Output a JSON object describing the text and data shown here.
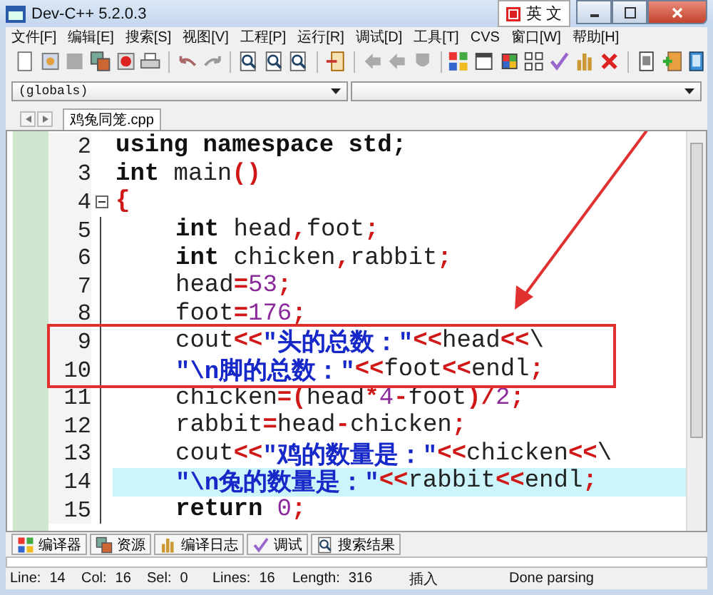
{
  "window": {
    "title": "Dev-C++ 5.2.0.3",
    "ime": "英 文"
  },
  "menu": [
    "文件[F]",
    "编辑[E]",
    "搜索[S]",
    "视图[V]",
    "工程[P]",
    "运行[R]",
    "调试[D]",
    "工具[T]",
    "CVS",
    "窗口[W]",
    "帮助[H]"
  ],
  "scope_combo": {
    "value": "(globals)"
  },
  "file_tabs": [
    {
      "label": "鸡兔同笼.cpp",
      "selected": true
    }
  ],
  "editor": {
    "lines": [
      {
        "number": "2",
        "highlighted": false,
        "tokens": [
          {
            "kind": "keyword",
            "text": "using namespace std;"
          }
        ]
      },
      {
        "number": "3",
        "highlighted": false,
        "tokens": [
          {
            "kind": "keyword",
            "text": "int"
          },
          {
            "kind": "plain",
            "text": " main"
          },
          {
            "kind": "op",
            "text": "()"
          }
        ]
      },
      {
        "number": "4",
        "highlighted": false,
        "tokens": [
          {
            "kind": "op",
            "text": "{"
          }
        ],
        "children": [
          {
            "number": "5",
            "highlighted": false,
            "tokens": [
              {
                "kind": "keyword",
                "text": "int"
              },
              {
                "kind": "plain",
                "text": " head"
              },
              {
                "kind": "op",
                "text": ","
              },
              {
                "kind": "plain",
                "text": "foot"
              },
              {
                "kind": "op",
                "text": ";"
              }
            ]
          },
          {
            "number": "6",
            "highlighted": false,
            "tokens": [
              {
                "kind": "keyword",
                "text": "int"
              },
              {
                "kind": "plain",
                "text": " chicken"
              },
              {
                "kind": "op",
                "text": ","
              },
              {
                "kind": "plain",
                "text": "rabbit"
              },
              {
                "kind": "op",
                "text": ";"
              }
            ]
          },
          {
            "number": "7",
            "highlighted": false,
            "tokens": [
              {
                "kind": "plain",
                "text": "head"
              },
              {
                "kind": "op",
                "text": "="
              },
              {
                "kind": "number",
                "text": "53"
              },
              {
                "kind": "op",
                "text": ";"
              }
            ]
          },
          {
            "number": "8",
            "highlighted": false,
            "tokens": [
              {
                "kind": "plain",
                "text": "foot"
              },
              {
                "kind": "op",
                "text": "="
              },
              {
                "kind": "number",
                "text": "176"
              },
              {
                "kind": "op",
                "text": ";"
              }
            ]
          },
          {
            "number": "9",
            "highlighted": false,
            "tokens": [
              {
                "kind": "plain",
                "text": "cout"
              },
              {
                "kind": "op",
                "text": "<<"
              },
              {
                "kind": "string",
                "text": "\"头的总数：\""
              },
              {
                "kind": "op",
                "text": "<<"
              },
              {
                "kind": "plain",
                "text": "head"
              },
              {
                "kind": "op",
                "text": "<<"
              },
              {
                "kind": "plain",
                "text": "\\"
              }
            ]
          },
          {
            "number": "10",
            "highlighted": false,
            "tokens": [
              {
                "kind": "string",
                "text": "\"\\n脚的总数：\""
              },
              {
                "kind": "op",
                "text": "<<"
              },
              {
                "kind": "plain",
                "text": "foot"
              },
              {
                "kind": "op",
                "text": "<<"
              },
              {
                "kind": "plain",
                "text": "endl"
              },
              {
                "kind": "op",
                "text": ";"
              }
            ]
          },
          {
            "number": "11",
            "highlighted": false,
            "tokens": [
              {
                "kind": "plain",
                "text": "chicken"
              },
              {
                "kind": "op",
                "text": "=("
              },
              {
                "kind": "plain",
                "text": "head"
              },
              {
                "kind": "op",
                "text": "*"
              },
              {
                "kind": "number",
                "text": "4"
              },
              {
                "kind": "op",
                "text": "-"
              },
              {
                "kind": "plain",
                "text": "foot"
              },
              {
                "kind": "op",
                "text": ")/"
              },
              {
                "kind": "number",
                "text": "2"
              },
              {
                "kind": "op",
                "text": ";"
              }
            ]
          },
          {
            "number": "12",
            "highlighted": false,
            "tokens": [
              {
                "kind": "plain",
                "text": "rabbit"
              },
              {
                "kind": "op",
                "text": "="
              },
              {
                "kind": "plain",
                "text": "head"
              },
              {
                "kind": "op",
                "text": "-"
              },
              {
                "kind": "plain",
                "text": "chicken"
              },
              {
                "kind": "op",
                "text": ";"
              }
            ]
          },
          {
            "number": "13",
            "highlighted": false,
            "tokens": [
              {
                "kind": "plain",
                "text": "cout"
              },
              {
                "kind": "op",
                "text": "<<"
              },
              {
                "kind": "string",
                "text": "\"鸡的数量是：\""
              },
              {
                "kind": "op",
                "text": "<<"
              },
              {
                "kind": "plain",
                "text": "chicken"
              },
              {
                "kind": "op",
                "text": "<<"
              },
              {
                "kind": "plain",
                "text": "\\"
              }
            ]
          },
          {
            "number": "14",
            "highlighted": true,
            "tokens": [
              {
                "kind": "string",
                "text": "\"\\n兔的数量是：\""
              },
              {
                "kind": "op",
                "text": "<<"
              },
              {
                "kind": "plain",
                "text": "rabbit"
              },
              {
                "kind": "op",
                "text": "<<"
              },
              {
                "kind": "plain",
                "text": "endl"
              },
              {
                "kind": "op",
                "text": ";"
              }
            ]
          },
          {
            "number": "15",
            "highlighted": false,
            "tokens": [
              {
                "kind": "keyword",
                "text": "return"
              },
              {
                "kind": "number",
                "text": "0"
              },
              {
                "kind": "op",
                "text": ";"
              }
            ]
          }
        ]
      }
    ]
  },
  "bottom_tabs": [
    {
      "label": "编译器"
    },
    {
      "label": "资源"
    },
    {
      "label": "编译日志"
    },
    {
      "label": "调试"
    },
    {
      "label": "搜索结果"
    }
  ],
  "status_bar": [
    {
      "label": "Line:",
      "value": "14"
    },
    {
      "label": "Col:",
      "value": "16"
    },
    {
      "label": "Sel:",
      "value": "0"
    },
    {
      "label": "Lines:",
      "value": "16"
    },
    {
      "label": "Length:",
      "value": "316"
    },
    {
      "value": "插入"
    },
    {
      "value": "Done parsing"
    }
  ]
}
